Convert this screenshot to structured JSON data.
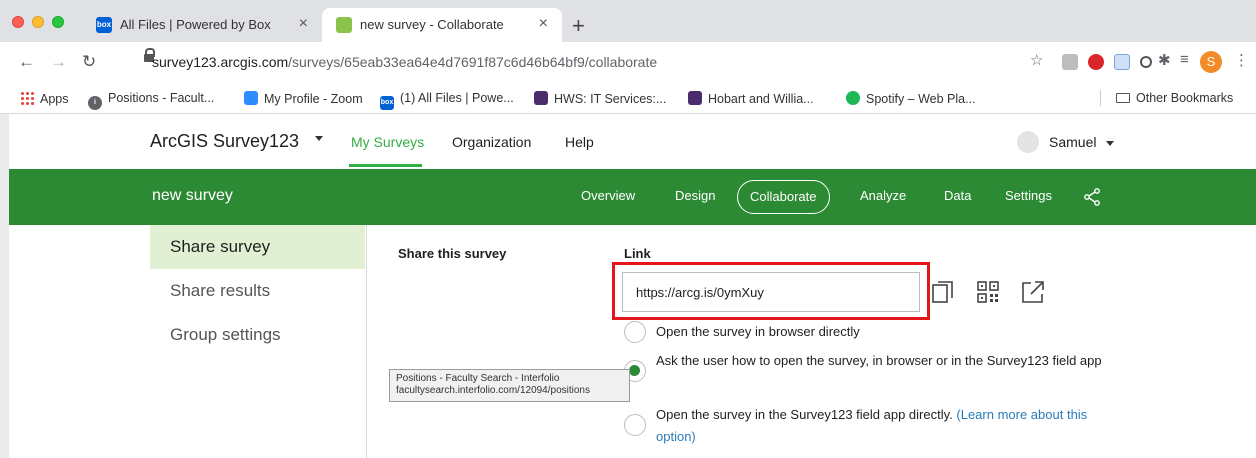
{
  "browser": {
    "tabs": [
      {
        "title": "All Files | Powered by Box",
        "favicon": "box",
        "active": false
      },
      {
        "title": "new survey - Collaborate",
        "favicon": "survey123",
        "active": true
      }
    ],
    "new_tab": "+",
    "url_host": "survey123.arcgis.com",
    "url_path": "/surveys/65eab33ea64e4d7691f87c6d46b64bf9/collaborate",
    "profile_initial": "S",
    "bookmarks": [
      {
        "label": "Apps",
        "icon": "apps-grid-icon"
      },
      {
        "label": "Positions - Facult...",
        "icon": "info-icon"
      },
      {
        "label": "My Profile - Zoom",
        "icon": "zoom-icon"
      },
      {
        "label": "(1) All Files | Powe...",
        "icon": "box-icon"
      },
      {
        "label": "HWS: IT Services:...",
        "icon": "hws-icon"
      },
      {
        "label": "Hobart and Willia...",
        "icon": "hws-icon"
      },
      {
        "label": "Spotify – Web Pla...",
        "icon": "spotify-icon"
      }
    ],
    "other_bookmarks": "Other Bookmarks"
  },
  "appnav": {
    "brand": "ArcGIS Survey123",
    "links": [
      "My Surveys",
      "Organization",
      "Help"
    ],
    "user": "Samuel"
  },
  "survey": {
    "title": "new survey",
    "tabs": [
      "Overview",
      "Design",
      "Collaborate",
      "Analyze",
      "Data",
      "Settings"
    ],
    "active_tab": "Collaborate"
  },
  "sidenav": {
    "items": [
      "Share survey",
      "Share results",
      "Group settings"
    ],
    "selected": "Share survey"
  },
  "share": {
    "section_label": "Share this survey",
    "link_label": "Link",
    "link_value": "https://arcg.is/0ymXuy",
    "options": [
      {
        "text": "Open the survey in browser directly",
        "checked": false
      },
      {
        "text": "Ask the user how to open the survey, in browser or in the Survey123 field app",
        "checked": true
      },
      {
        "text": "Open the survey in the Survey123 field app directly.",
        "learn_more": "(Learn more about this option)",
        "checked": false
      }
    ]
  },
  "tooltip": {
    "line1": "Positions - Faculty Search - Interfolio",
    "line2": "facultysearch.interfolio.com/12094/positions"
  },
  "colors": {
    "brand_green": "#2d8a34",
    "accent_green": "#35ac46",
    "selected_bg": "#e1f0d3",
    "highlight_red": "#e5161b",
    "link_blue": "#2b7bb9"
  }
}
